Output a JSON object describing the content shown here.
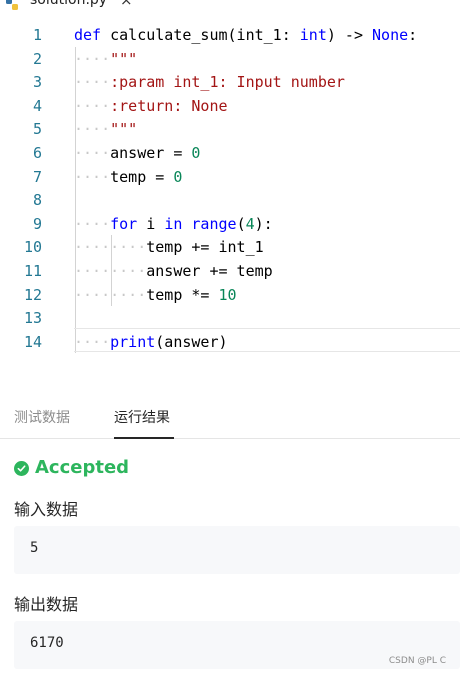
{
  "editor_tab": {
    "file_name": "solution.py",
    "close_glyph": "×",
    "icon": "python-icon"
  },
  "code_lines": [
    {
      "num": "1",
      "parts": [
        [
          "kw",
          "def"
        ],
        [
          "plain",
          " calculate_sum(int_1: "
        ],
        [
          "kw",
          "int"
        ],
        [
          "plain",
          ") -> "
        ],
        [
          "kw",
          "None"
        ],
        [
          "plain",
          ":"
        ]
      ]
    },
    {
      "num": "2",
      "indent": 1,
      "parts": [
        [
          "str",
          "\"\"\""
        ]
      ]
    },
    {
      "num": "3",
      "indent": 1,
      "parts": [
        [
          "str",
          ":param int_1: Input number"
        ]
      ]
    },
    {
      "num": "4",
      "indent": 1,
      "parts": [
        [
          "str",
          ":return: None"
        ]
      ]
    },
    {
      "num": "5",
      "indent": 1,
      "parts": [
        [
          "str",
          "\"\"\""
        ]
      ]
    },
    {
      "num": "6",
      "indent": 1,
      "parts": [
        [
          "plain",
          "answer = "
        ],
        [
          "num",
          "0"
        ]
      ]
    },
    {
      "num": "7",
      "indent": 1,
      "parts": [
        [
          "plain",
          "temp = "
        ],
        [
          "num",
          "0"
        ]
      ]
    },
    {
      "num": "8",
      "parts": []
    },
    {
      "num": "9",
      "indent": 1,
      "parts": [
        [
          "kw",
          "for"
        ],
        [
          "plain",
          " i "
        ],
        [
          "kw",
          "in"
        ],
        [
          "plain",
          " "
        ],
        [
          "kw",
          "range"
        ],
        [
          "plain",
          "("
        ],
        [
          "num",
          "4"
        ],
        [
          "plain",
          "):"
        ]
      ]
    },
    {
      "num": "10",
      "indent": 2,
      "parts": [
        [
          "plain",
          "temp += int_1"
        ]
      ]
    },
    {
      "num": "11",
      "indent": 2,
      "parts": [
        [
          "plain",
          "answer += temp"
        ]
      ]
    },
    {
      "num": "12",
      "indent": 2,
      "parts": [
        [
          "plain",
          "temp *= "
        ],
        [
          "num",
          "10"
        ]
      ]
    },
    {
      "num": "13",
      "parts": []
    },
    {
      "num": "14",
      "indent": 1,
      "parts": [
        [
          "kw",
          "print"
        ],
        [
          "plain",
          "(answer)"
        ]
      ]
    }
  ],
  "colors": {
    "keyword": "#0000ff",
    "string": "#a31515",
    "number": "#098658",
    "line_number": "#237893",
    "accepted": "#2db55d"
  },
  "result_tabs": [
    {
      "label": "测试数据",
      "active": false
    },
    {
      "label": "运行结果",
      "active": true
    }
  ],
  "status": {
    "label": "Accepted",
    "icon": "check-circle-icon"
  },
  "input_section": {
    "label": "输入数据",
    "value": "5"
  },
  "output_section": {
    "label": "输出数据",
    "value": "6170"
  },
  "watermark": "CSDN @PL C"
}
